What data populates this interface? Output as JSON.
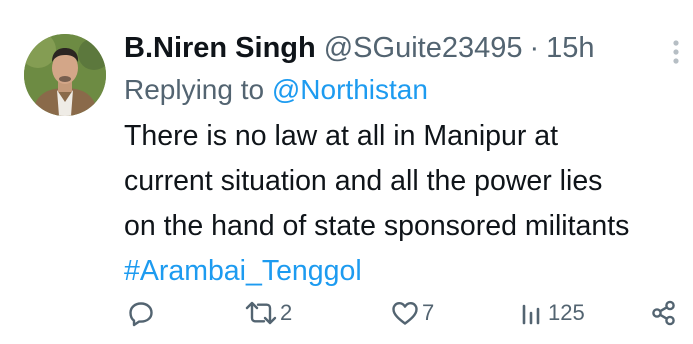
{
  "tweet": {
    "name": "B.Niren Singh",
    "handle": "@SGuite23495",
    "separator": "·",
    "time": "15h",
    "replying_prefix": "Replying to",
    "replying_to": "@Northistan",
    "text_lines": [
      "There is no law at all in Manipur at",
      "current situation and all the power lies",
      "on the hand of state sponsored militants"
    ],
    "hashtag": "#Arambai_Tenggol"
  },
  "actions": {
    "reply_icon": "reply-icon",
    "retweet_icon": "retweet-icon",
    "retweet_count": "2",
    "like_icon": "heart-icon",
    "like_count": "7",
    "views_icon": "views-icon",
    "views_count": "125",
    "share_icon": "share-icon"
  },
  "colors": {
    "text": "#0f1419",
    "secondary": "#536471",
    "accent": "#1d9bf0"
  }
}
